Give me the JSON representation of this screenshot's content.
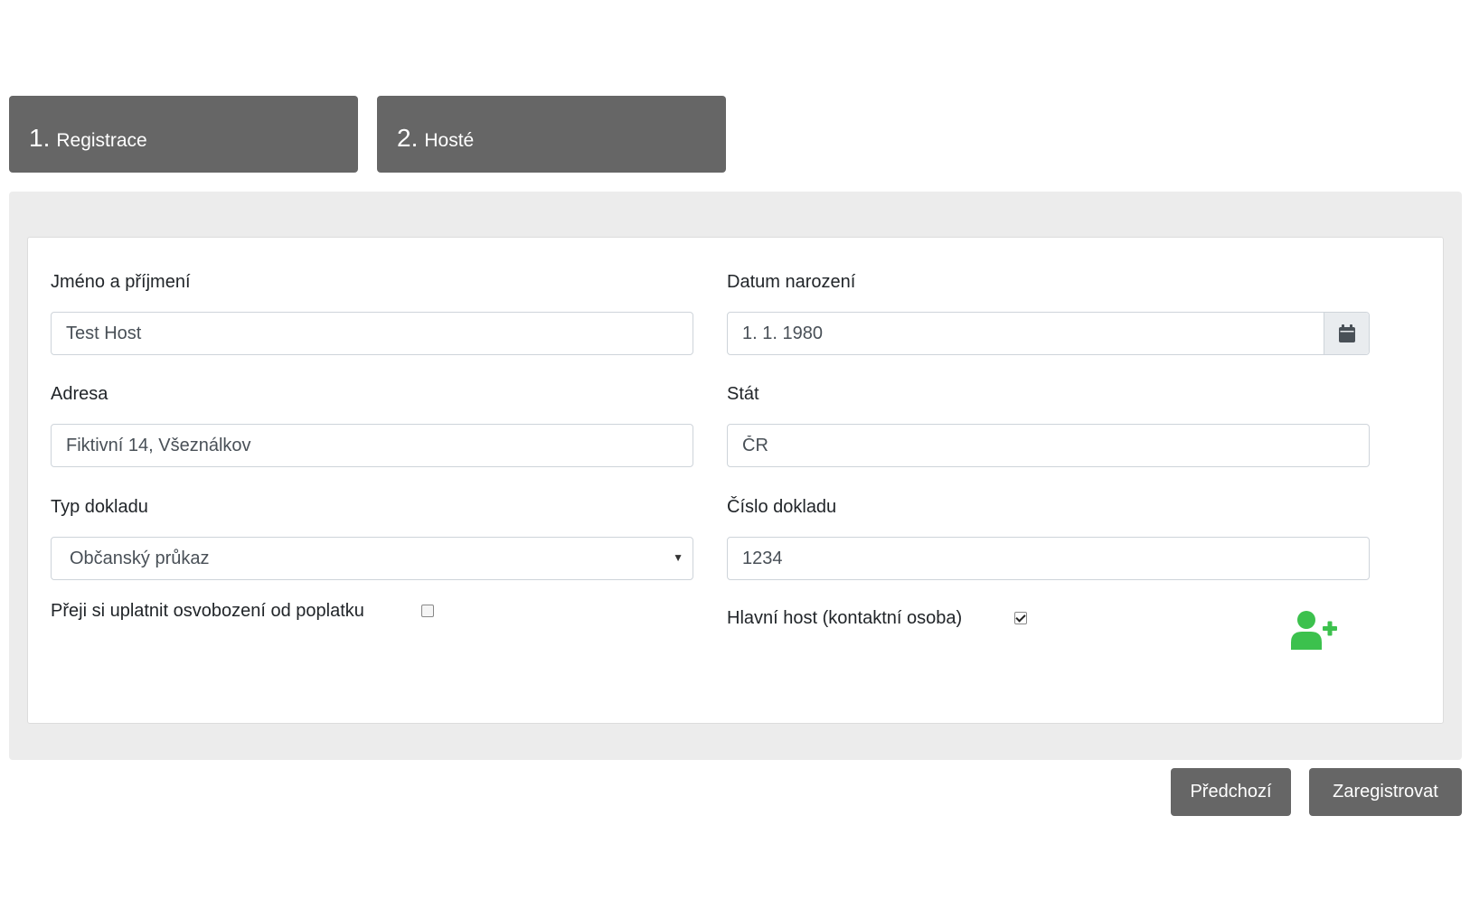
{
  "steps": [
    {
      "number": "1.",
      "label": "Registrace"
    },
    {
      "number": "2.",
      "label": "Hosté"
    }
  ],
  "form": {
    "name": {
      "label": "Jméno a příjmení",
      "value": "Test Host"
    },
    "birthdate": {
      "label": "Datum narození",
      "value": "1. 1. 1980",
      "icon": "calendar-icon"
    },
    "address": {
      "label": "Adresa",
      "value": "Fiktivní 14, Všeználkov"
    },
    "country": {
      "label": "Stát",
      "value": "ČR"
    },
    "doc_type": {
      "label": "Typ dokladu",
      "value": "Občanský průkaz"
    },
    "doc_number": {
      "label": "Číslo dokladu",
      "value": "1234"
    },
    "fee_exemption": {
      "label": "Přeji si uplatnit osvobození od poplatku",
      "checked": false
    },
    "main_guest": {
      "label": "Hlavní host (kontaktní osoba)",
      "checked": true
    },
    "add_guest_icon": "add-user-icon"
  },
  "buttons": {
    "previous": "Předchozí",
    "register": "Zaregistrovat"
  },
  "colors": {
    "step_bg": "#666666",
    "panel_bg": "#ececec",
    "add_user": "#3cc14d"
  }
}
